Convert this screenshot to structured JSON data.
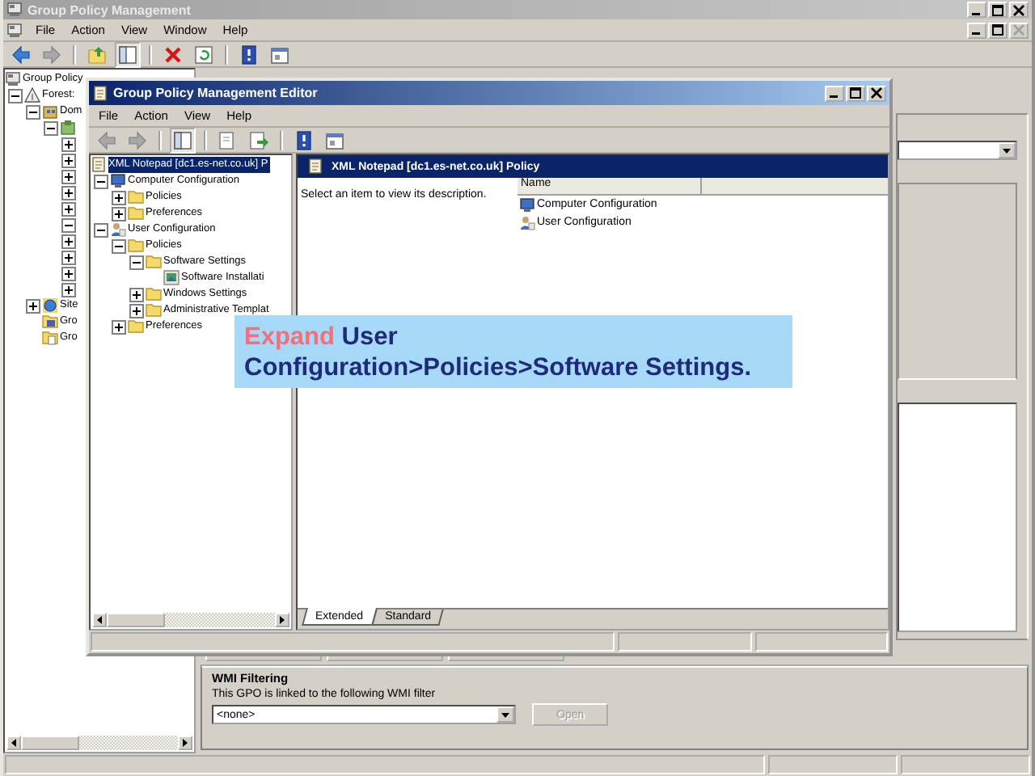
{
  "main_window": {
    "title": "Group Policy Management",
    "active": false,
    "menu": [
      "File",
      "Action",
      "View",
      "Window",
      "Help"
    ],
    "tree": [
      {
        "label": "Group Policy",
        "kind": "console",
        "selected": false,
        "children": [
          {
            "label": "Forest:",
            "kind": "forest",
            "expanded": true,
            "selected": false,
            "children": [
              {
                "label": "Dom",
                "kind": "domain",
                "expanded": true,
                "selected": false,
                "children": [
                  {
                    "kind": "container",
                    "expanded": true,
                    "children": [
                      {
                        "expanded": false
                      },
                      {
                        "expanded": false
                      },
                      {
                        "expanded": false
                      },
                      {
                        "expanded": false
                      },
                      {
                        "expanded": false
                      },
                      {
                        "expanded": true
                      },
                      {
                        "expanded": false
                      },
                      {
                        "expanded": false
                      },
                      {
                        "expanded": false
                      },
                      {
                        "expanded": false
                      }
                    ]
                  }
                ]
              },
              {
                "label": "Site",
                "kind": "sites",
                "expanded": false,
                "selected": false
              },
              {
                "label": "Gro",
                "kind": "gpos",
                "selected": false
              },
              {
                "label": "Gro",
                "kind": "starter",
                "selected": false
              }
            ]
          }
        ]
      }
    ],
    "wmi_filtering": {
      "heading": "WMI Filtering",
      "description": "This GPO is linked to the following WMI filter",
      "filter": {
        "value": "<none>"
      },
      "open_button": {
        "label": "Open",
        "disabled": true
      }
    }
  },
  "editor_window": {
    "title": "Group Policy Management Editor",
    "active": true,
    "menu": [
      "File",
      "Action",
      "View",
      "Help"
    ],
    "tree": [
      {
        "label": "XML Notepad [dc1.es-net.co.uk] P",
        "kind": "gpo",
        "selected": true,
        "children": [
          {
            "label": "Computer Configuration",
            "kind": "computer",
            "expanded": true,
            "selected": false,
            "children": [
              {
                "label": "Policies",
                "kind": "folder",
                "expanded": false,
                "selected": false
              },
              {
                "label": "Preferences",
                "kind": "folder",
                "expanded": false,
                "selected": false
              }
            ]
          },
          {
            "label": "User Configuration",
            "kind": "user",
            "expanded": true,
            "selected": false,
            "children": [
              {
                "label": "Policies",
                "kind": "folder",
                "expanded": true,
                "selected": false,
                "children": [
                  {
                    "label": "Software Settings",
                    "kind": "folder",
                    "expanded": true,
                    "selected": false,
                    "children": [
                      {
                        "label": "Software Installati",
                        "kind": "app",
                        "selected": false
                      }
                    ]
                  },
                  {
                    "label": "Windows Settings",
                    "kind": "folder",
                    "expanded": false,
                    "selected": false
                  },
                  {
                    "label": "Administrative Templat",
                    "kind": "folder",
                    "expanded": false,
                    "selected": false
                  }
                ]
              },
              {
                "label": "Preferences",
                "kind": "folder",
                "expanded": false,
                "selected": false
              }
            ]
          }
        ]
      }
    ],
    "details": {
      "header": "XML Notepad [dc1.es-net.co.uk] Policy",
      "description": "Select an item to view its description.",
      "column": "Name",
      "items": [
        {
          "label": "Computer Configuration",
          "kind": "computer",
          "selected": false
        },
        {
          "label": "User Configuration",
          "kind": "user",
          "selected": false
        }
      ]
    },
    "tabs": [
      {
        "label": "Extended",
        "selected": true
      },
      {
        "label": "Standard",
        "selected": false
      }
    ]
  },
  "callout": {
    "verb": "Expand",
    "path": "User Configuration>Policies>Software Settings."
  }
}
